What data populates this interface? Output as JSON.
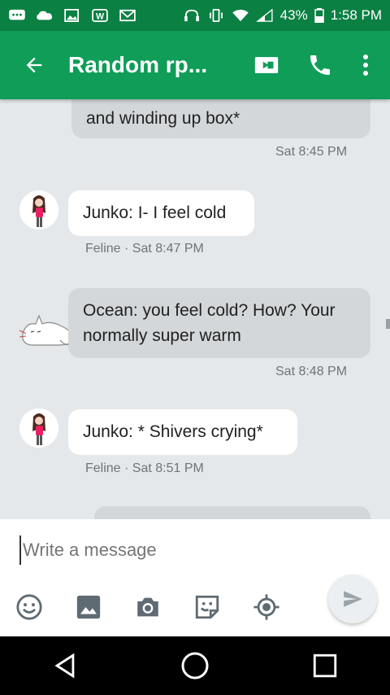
{
  "status_bar": {
    "battery": "43%",
    "time": "1:58 PM"
  },
  "app_bar": {
    "title": "Random rp..."
  },
  "messages": [
    {
      "id": "m1",
      "direction": "outgoing",
      "text": "and winding up box*",
      "meta": "Sat 8:45 PM"
    },
    {
      "id": "m2",
      "direction": "incoming",
      "text": "Junko: I- I feel cold",
      "meta": "Feline · Sat 8:47 PM"
    },
    {
      "id": "m3",
      "direction": "outgoing",
      "line1": "Ocean: you feel cold? How? Your",
      "line2": "normally super warm",
      "meta": "Sat 8:48 PM"
    },
    {
      "id": "m4",
      "direction": "incoming",
      "text": "Junko: * Shivers crying*",
      "meta": "Feline · Sat 8:51 PM"
    }
  ],
  "composer": {
    "placeholder": "Write a message"
  },
  "colors": {
    "status_bar": "#0b8043",
    "app_bar": "#0f9d58",
    "chat_bg": "#e5e8ea",
    "outgoing_bubble": "#d3d7da",
    "incoming_bubble": "#ffffff"
  }
}
